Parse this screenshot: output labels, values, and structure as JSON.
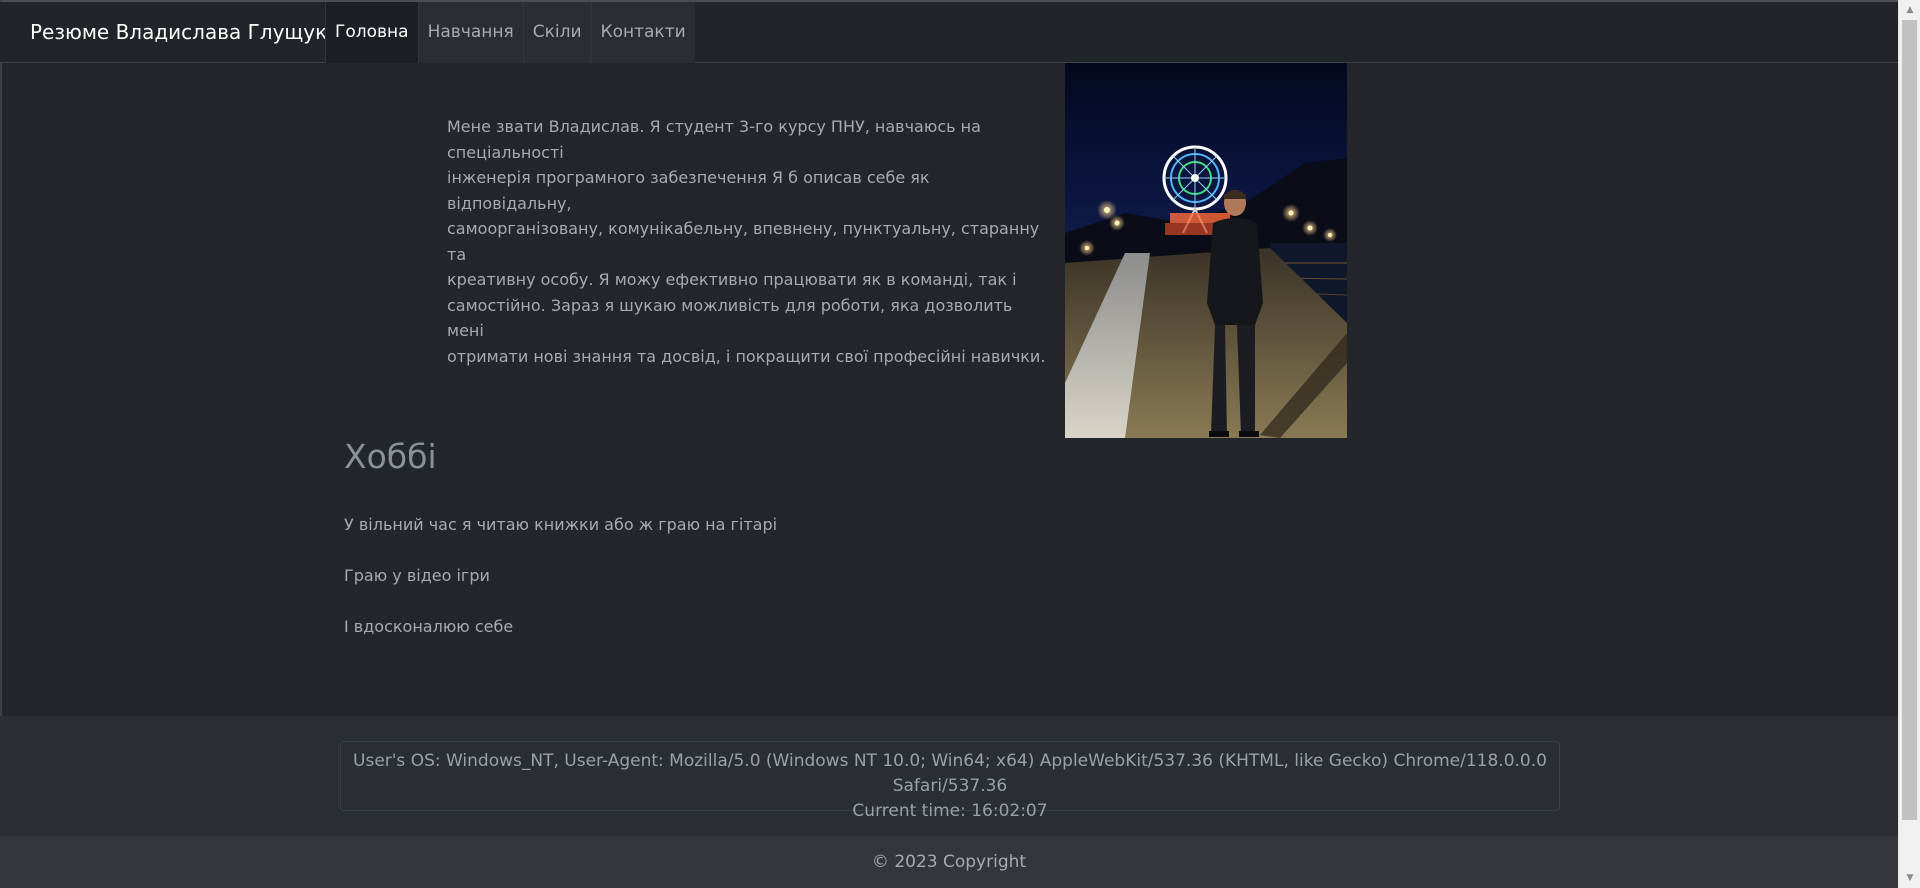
{
  "navbar": {
    "brand": "Резюме Владислава Глущука",
    "items": [
      {
        "label": "Головна",
        "active": true
      },
      {
        "label": "Навчання",
        "active": false
      },
      {
        "label": "Скіли",
        "active": false
      },
      {
        "label": "Контакти",
        "active": false
      }
    ]
  },
  "about": {
    "lines": [
      "Мене звати Владислав. Я студент 3-го курсу ПНУ, навчаюсь на спеціальності",
      "інженерія програмного забезпечення Я б описав себе як відповідальну,",
      "самоорганізовану, комунікабельну, впевнену, пунктуальну, старанну та",
      "креативну особу. Я можу ефективно працювати як в команді, так і",
      "самостійно. Зараз я шукаю можливість для роботи, яка дозволить мені",
      "отримати нові знання та досвід, і покращити свої професійні навички."
    ]
  },
  "hobbies": {
    "title": "Хоббі",
    "items": [
      "У вільний час я читаю книжки або ж граю на гітарі",
      "Граю у відео ігри",
      "І вдосконалюю себе"
    ]
  },
  "info": {
    "os_line": "User's OS: Windows_NT, User-Agent: Mozilla/5.0 (Windows NT 10.0; Win64; x64) AppleWebKit/537.36 (KHTML, like Gecko) Chrome/118.0.0.0 Safari/537.36",
    "time_line": "Current time: 16:02:07"
  },
  "footer": {
    "copyright": "© 2023 Copyright"
  },
  "colors": {
    "page_bg": "#23262b",
    "navbar_bg": "#212529",
    "info_bg": "#2b2f35",
    "footer_bg": "#33373c",
    "text": "#a7abb0",
    "heading": "#8b9197"
  }
}
